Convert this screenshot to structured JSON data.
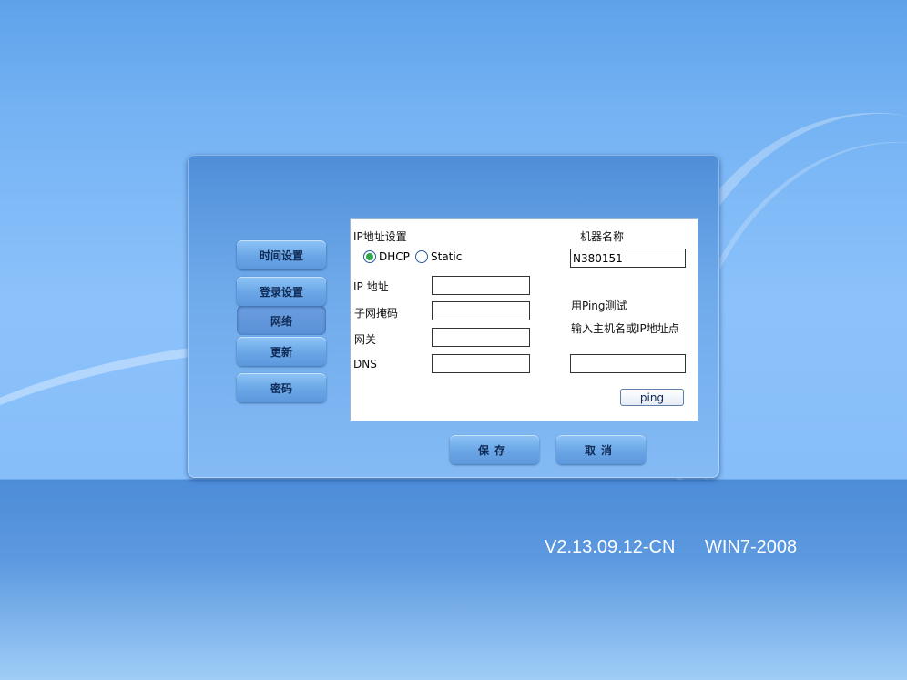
{
  "nav": {
    "items": [
      {
        "label": "时间设置"
      },
      {
        "label": "登录设置"
      },
      {
        "label": "网络"
      },
      {
        "label": "更新"
      },
      {
        "label": "密码"
      }
    ]
  },
  "network": {
    "section_title": "IP地址设置",
    "dhcp_label": "DHCP",
    "static_label": "Static",
    "selected_mode": "DHCP",
    "ip_label": "IP 地址",
    "subnet_label": "子网掩码",
    "gateway_label": "网关",
    "dns_label": "DNS",
    "ip_value": "",
    "subnet_value": "",
    "gateway_value": "",
    "dns_value": ""
  },
  "machine": {
    "label": "机器名称",
    "value": "N380151"
  },
  "ping": {
    "title": "用Ping测试",
    "hint": "输入主机名或IP地址点",
    "value": "",
    "button_label": "ping"
  },
  "actions": {
    "save_label": "保存",
    "cancel_label": "取消"
  },
  "footer": {
    "version": "V2.13.09.12-CN",
    "os": "WIN7-2008"
  },
  "colors": {
    "radio_selected": "#2ea84a",
    "panel_bg": "#ffffff"
  }
}
